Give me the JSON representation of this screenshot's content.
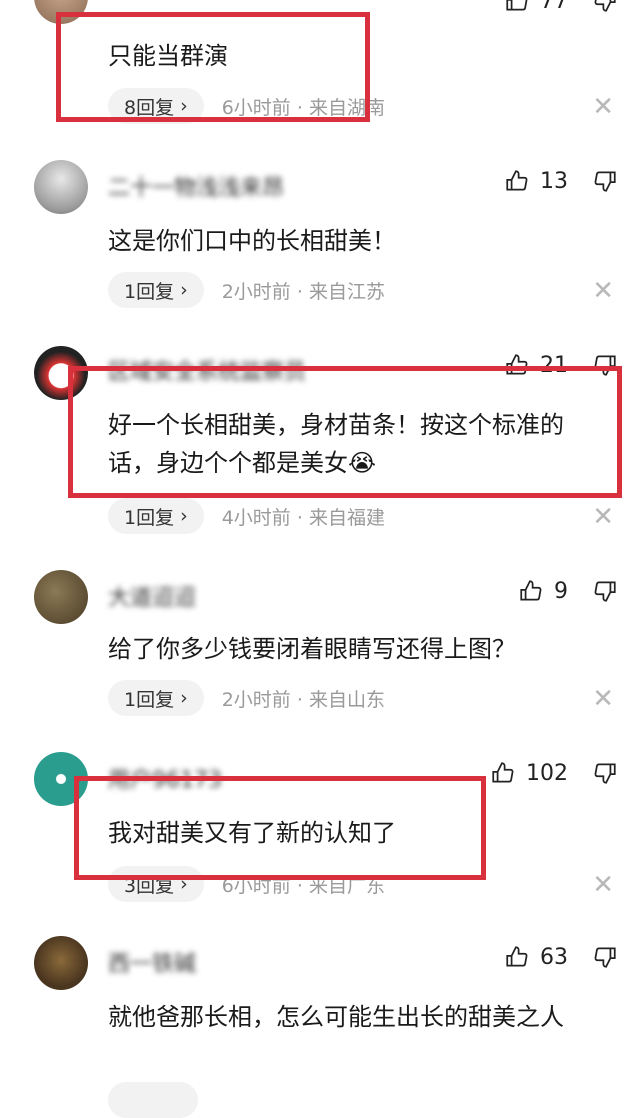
{
  "comments": [
    {
      "username": "",
      "likes": "77",
      "text": "只能当群演",
      "replies": "8回复",
      "time": "6小时前",
      "location": "来自湖南"
    },
    {
      "username": "二十一物浅浅来昂",
      "likes": "13",
      "text": "这是你们口中的长相甜美！",
      "replies": "1回复",
      "time": "2小时前",
      "location": "来自江苏"
    },
    {
      "username": "区域安全系统监察员",
      "likes": "21",
      "text": "好一个长相甜美，身材苗条！按这个标准的话，身边个个都是美女",
      "replies": "1回复",
      "time": "4小时前",
      "location": "来自福建"
    },
    {
      "username": "大道迢迢",
      "likes": "9",
      "text": "给了你多少钱要闭着眼睛写还得上图？",
      "replies": "1回复",
      "time": "2小时前",
      "location": "来自山东"
    },
    {
      "username": "用户96173",
      "likes": "102",
      "text": "我对甜美又有了新的认知了",
      "replies": "3回复",
      "time": "6小时前",
      "location": "来自广东"
    },
    {
      "username": "西一铁碱",
      "likes": "63",
      "text": "就他爸那长相，怎么可能生出长的甜美之人",
      "replies": "",
      "time": "",
      "location": ""
    }
  ],
  "ui": {
    "separator": "·",
    "chevron": "›",
    "close": "✕",
    "emoji": "😭"
  },
  "colors": {
    "highlight": "#d9303e",
    "meta": "#9a9a9a",
    "pill": "#f2f2f2"
  }
}
